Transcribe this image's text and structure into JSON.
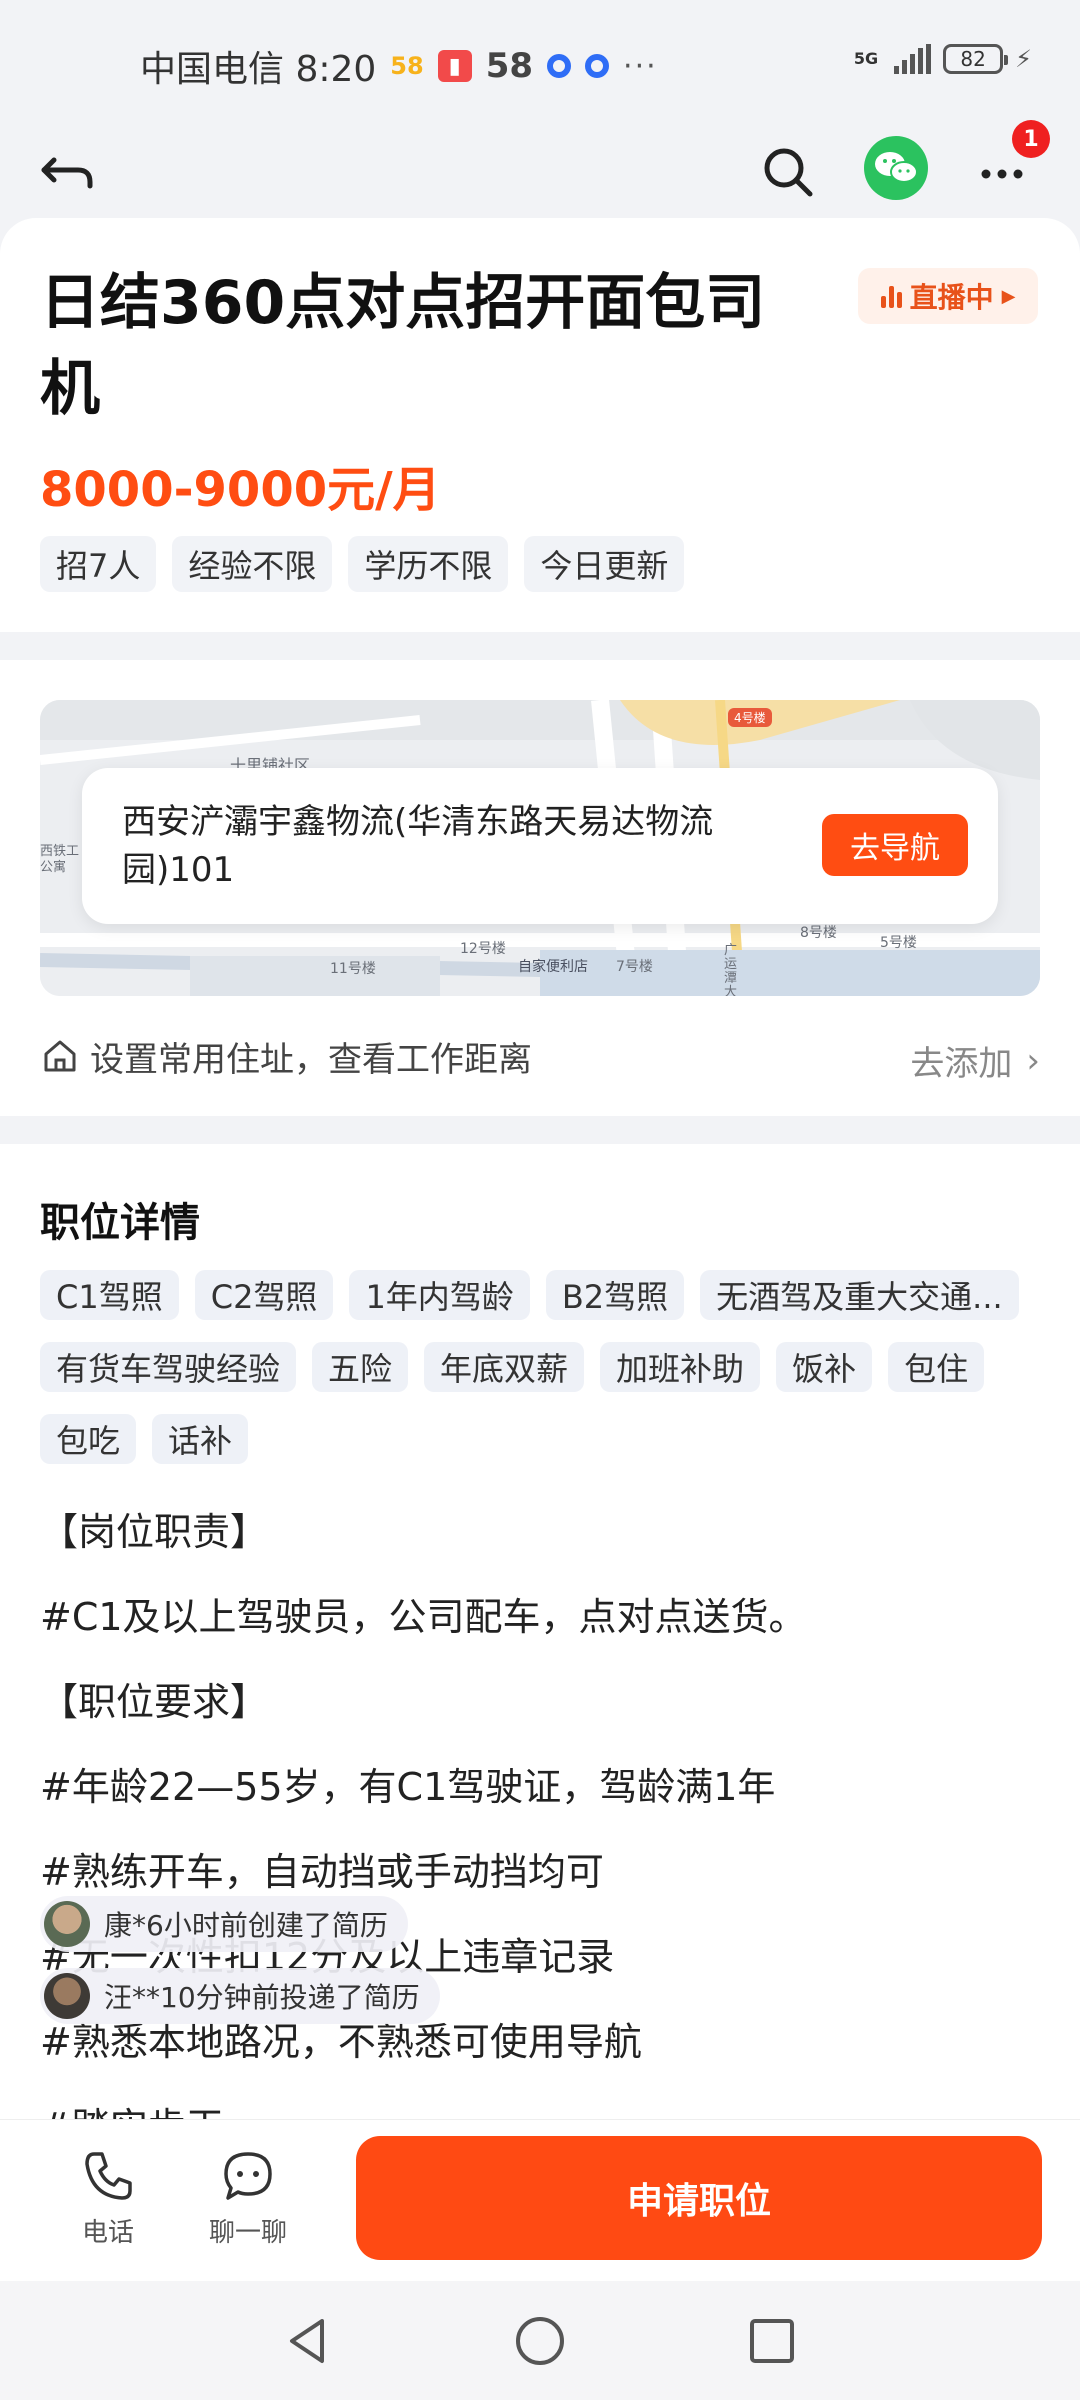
{
  "status_bar": {
    "carrier_time": "中国电信 8:20",
    "icons": [
      "58-app-icon",
      "book-app-icon",
      "58-icon",
      "blue-circle-icon",
      "blue-circle-icon",
      "more-dots-icon"
    ],
    "app_58_small": "58",
    "app_58": "58",
    "dots": "···",
    "network": "5G",
    "battery": "82"
  },
  "nav": {
    "icons": [
      "back-arrow-icon",
      "search-icon",
      "wechat-icon",
      "more-icon"
    ],
    "badge_count": "1"
  },
  "job": {
    "title": "日结360点对点招开面包司机",
    "live_label": "直播中",
    "salary": "8000-9000元/月",
    "tags": [
      "招7人",
      "经验不限",
      "学历不限",
      "今日更新"
    ]
  },
  "location": {
    "map_labels": [
      "十里铺社区",
      "4号楼",
      "西铁工公寓",
      "11号楼",
      "12号楼",
      "自家便利店",
      "7号楼",
      "广运潭大道",
      "8号楼",
      "5号楼"
    ],
    "address": "西安浐灞宇鑫物流(华清东路天易达物流园)101",
    "navigate_label": "去导航",
    "home_prompt": "设置常用住址，查看工作距离",
    "add_label": "去添加"
  },
  "details": {
    "title": "职位详情",
    "tags": [
      "C1驾照",
      "C2驾照",
      "1年内驾龄",
      "B2驾照",
      "无酒驾及重大交通...",
      "有货车驾驶经验",
      "五险",
      "年底双薪",
      "加班补助",
      "饭补",
      "包住",
      "包吃",
      "话补"
    ],
    "lines": [
      "【岗位职责】",
      "#C1及以上驾驶员，公司配车，点对点送货。",
      "【职位要求】",
      "#年龄22—55岁，有C1驾驶证，驾龄满1年",
      "#熟练开车，自动挡或手动挡均可",
      "#无一次性扣12分及以上违章记录",
      "#熟悉本地路况，不熟悉可使用导航",
      "#踏实肯干"
    ],
    "notifications": [
      "康*6小时前创建了简历",
      "汪**10分钟前投递了简历"
    ]
  },
  "bottom": {
    "call_label": "电话",
    "chat_label": "聊一聊",
    "apply_label": "申请职位"
  },
  "colors": {
    "accent": "#ff4d12",
    "wechat": "#2bc25f",
    "tag_bg": "#f1f3f7",
    "badge": "#ef2020"
  }
}
